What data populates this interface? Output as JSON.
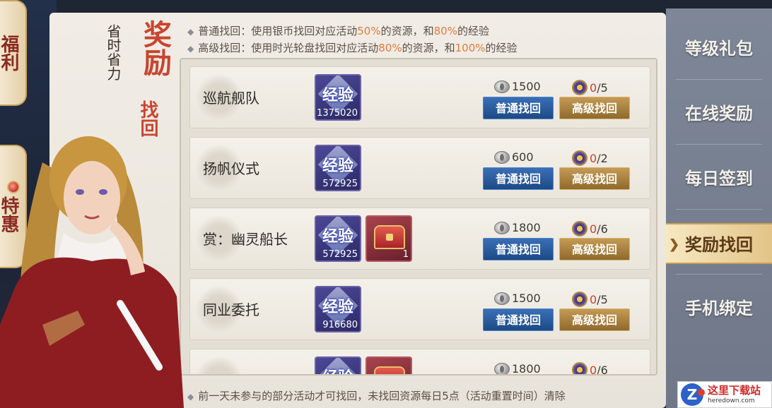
{
  "side_tabs": [
    {
      "text": "福利"
    },
    {
      "text": "特惠"
    }
  ],
  "header": {
    "subtitle": "省时省力",
    "title_big": "奖励",
    "title_small": "找回"
  },
  "info": {
    "line1": {
      "prefix": "普通找回：使用银币找回对应活动",
      "p1": "50%",
      "mid": "的资源，和",
      "p2": "80%",
      "suffix": "的经验"
    },
    "line2": {
      "prefix": "高级找回：使用时光轮盘找回对应活动",
      "p1": "80%",
      "mid": "的资源，和",
      "p2": "100%",
      "suffix": "的经验"
    }
  },
  "exp_label": "经验",
  "buttons": {
    "normal": "普通找回",
    "advanced": "高级找回"
  },
  "rows": [
    {
      "name": "巡航舰队",
      "exp": "1375020",
      "chest": null,
      "silver_cost": "1500",
      "advanced_count": "0",
      "advanced_max": "/5"
    },
    {
      "name": "扬帆仪式",
      "exp": "572925",
      "chest": null,
      "silver_cost": "600",
      "advanced_count": "0",
      "advanced_max": "/2"
    },
    {
      "name": "赏：幽灵船长",
      "exp": "572925",
      "chest": "1",
      "silver_cost": "1800",
      "advanced_count": "0",
      "advanced_max": "/6"
    },
    {
      "name": "同业委托",
      "exp": "916680",
      "chest": null,
      "silver_cost": "1500",
      "advanced_count": "0",
      "advanced_max": "/5"
    },
    {
      "name": "",
      "exp": "",
      "chest": "",
      "silver_cost": "1800",
      "advanced_count": "0",
      "advanced_max": "/6"
    }
  ],
  "footer": "前一天未参与的部分活动才可找回，未找回资源每日5点（活动重置时间）清除",
  "nav": {
    "items": [
      "等级礼包",
      "在线奖励",
      "每日签到",
      "奖励找回",
      "手机绑定"
    ],
    "active": "奖励找回"
  },
  "watermark": {
    "title": "这里下载站",
    "url": "heredown.com",
    "logo": "Z"
  },
  "colors": {
    "highlight": "#e07a3c",
    "title_red": "#c8452f",
    "normal_btn": "#2a5c9e",
    "advanced_btn": "#a87e3e",
    "count_red": "#d33c2a"
  }
}
